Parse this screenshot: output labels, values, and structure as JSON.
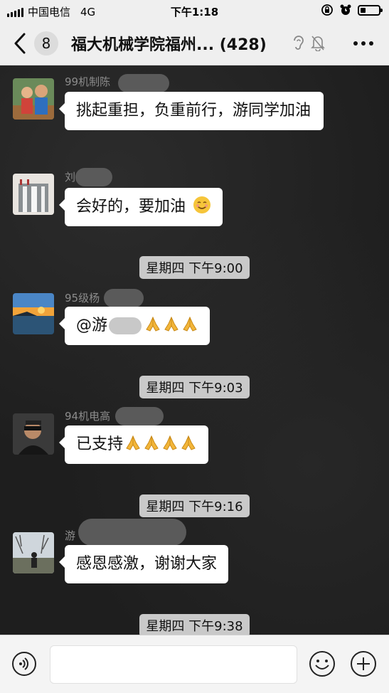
{
  "status_bar": {
    "carrier": "中国电信",
    "network": "4G",
    "time": "下午1:18"
  },
  "nav": {
    "unread_count": "8",
    "title": "福大机械学院福州...",
    "member_count": "(428)"
  },
  "messages": [
    {
      "sender": "99机制陈",
      "text": "挑起重担，负重前行，游同学加油"
    },
    {
      "sender": "刘",
      "text": "会好的，要加油"
    },
    {
      "sender": "95级杨",
      "text_prefix": "@游"
    },
    {
      "sender": "94机电高",
      "text": "已支持"
    },
    {
      "sender": "游",
      "text": "感恩感激，谢谢大家"
    }
  ],
  "timestamps": [
    "星期四 下午9:00",
    "星期四 下午9:03",
    "星期四 下午9:16",
    "星期四 下午9:38"
  ],
  "icons": {
    "back": "chevron-left-icon",
    "ear": "ear-icon",
    "mute": "bell-off-icon",
    "more": "more-icon",
    "voice": "voice-icon",
    "emoji": "emoji-icon",
    "plus": "plus-icon",
    "pray": "folded-hands-icon",
    "smile": "smiling-face-icon"
  },
  "battery_level": 0.28
}
